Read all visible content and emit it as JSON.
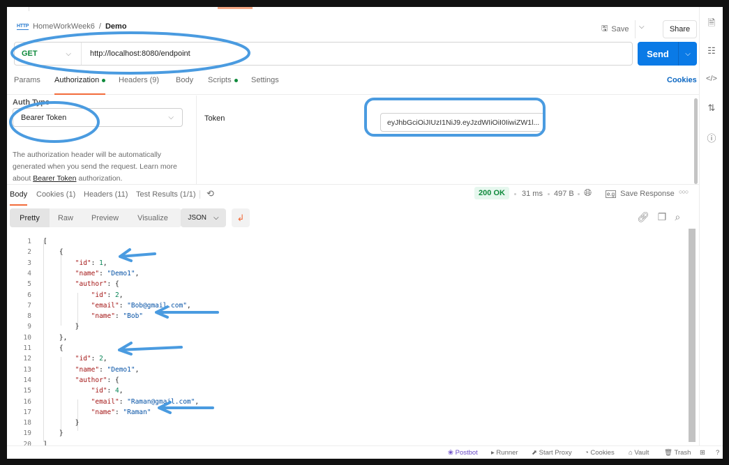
{
  "header": {
    "collection": "HomeWorkWeek6",
    "separator": "/",
    "request_name": "Demo",
    "http_badge": "HTTP",
    "save_label": "Save",
    "share_label": "Share"
  },
  "request": {
    "method": "GET",
    "url": "http://localhost:8080/endpoint",
    "send_label": "Send"
  },
  "request_tabs": [
    {
      "label": "Params",
      "active": false
    },
    {
      "label": "Authorization",
      "active": true,
      "dot": true
    },
    {
      "label": "Headers (9)",
      "active": false
    },
    {
      "label": "Body",
      "active": false
    },
    {
      "label": "Scripts",
      "active": false,
      "dot": true
    },
    {
      "label": "Settings",
      "active": false
    }
  ],
  "cookies_link": "Cookies",
  "auth": {
    "type_label": "Auth Type",
    "type_value": "Bearer Token",
    "help_prefix": "The authorization header will be automatically generated when you send the request. Learn more about ",
    "help_link": "Bearer Token",
    "help_suffix": " authorization.",
    "token_label": "Token",
    "token_value": "eyJhbGciOiJIUzI1NiJ9.eyJzdWIiOiI0IiwiZW1l..."
  },
  "response_tabs": [
    {
      "label": "Body",
      "active": true
    },
    {
      "label": "Cookies (1)",
      "active": false
    },
    {
      "label": "Headers (11)",
      "active": false
    },
    {
      "label": "Test Results (1/1)",
      "active": false
    }
  ],
  "response_meta": {
    "status": "200 OK",
    "time": "31 ms",
    "size": "497 B",
    "save_response": "Save Response"
  },
  "view_modes": [
    {
      "label": "Pretty",
      "active": true
    },
    {
      "label": "Raw",
      "active": false
    },
    {
      "label": "Preview",
      "active": false
    },
    {
      "label": "Visualize",
      "active": false
    }
  ],
  "format": "JSON",
  "code_lines": [
    {
      "n": "1",
      "html": "["
    },
    {
      "n": "2",
      "html": "    {"
    },
    {
      "n": "3",
      "html": "        <span class=\"k\">\"id\"</span>: <span class=\"n\">1</span>,"
    },
    {
      "n": "4",
      "html": "        <span class=\"k\">\"name\"</span>: <span class=\"s\">\"Demo1\"</span>,"
    },
    {
      "n": "5",
      "html": "        <span class=\"k\">\"author\"</span>: {"
    },
    {
      "n": "6",
      "html": "            <span class=\"k\">\"id\"</span>: <span class=\"n\">2</span>,"
    },
    {
      "n": "7",
      "html": "            <span class=\"k\">\"email\"</span>: <span class=\"s\">\"Bob@gmail.com\"</span>,"
    },
    {
      "n": "8",
      "html": "            <span class=\"k\">\"name\"</span>: <span class=\"s\">\"Bob\"</span>"
    },
    {
      "n": "9",
      "html": "        }"
    },
    {
      "n": "10",
      "html": "    },"
    },
    {
      "n": "11",
      "html": "    {"
    },
    {
      "n": "12",
      "html": "        <span class=\"k\">\"id\"</span>: <span class=\"n\">2</span>,"
    },
    {
      "n": "13",
      "html": "        <span class=\"k\">\"name\"</span>: <span class=\"s\">\"Demo1\"</span>,"
    },
    {
      "n": "14",
      "html": "        <span class=\"k\">\"author\"</span>: {"
    },
    {
      "n": "15",
      "html": "            <span class=\"k\">\"id\"</span>: <span class=\"n\">4</span>,"
    },
    {
      "n": "16",
      "html": "            <span class=\"k\">\"email\"</span>: <span class=\"s\">\"Raman@gmail.com\"</span>,"
    },
    {
      "n": "17",
      "html": "            <span class=\"k\">\"name\"</span>: <span class=\"s\">\"Raman\"</span>"
    },
    {
      "n": "18",
      "html": "        }"
    },
    {
      "n": "19",
      "html": "    }"
    },
    {
      "n": "20",
      "html": "]"
    }
  ],
  "statusbar": {
    "postbot": "Postbot",
    "runner": "Runner",
    "start_proxy": "Start Proxy",
    "cookies": "Cookies",
    "vault": "Vault",
    "trash": "Trash"
  },
  "annotation_color": "#4a9be0"
}
